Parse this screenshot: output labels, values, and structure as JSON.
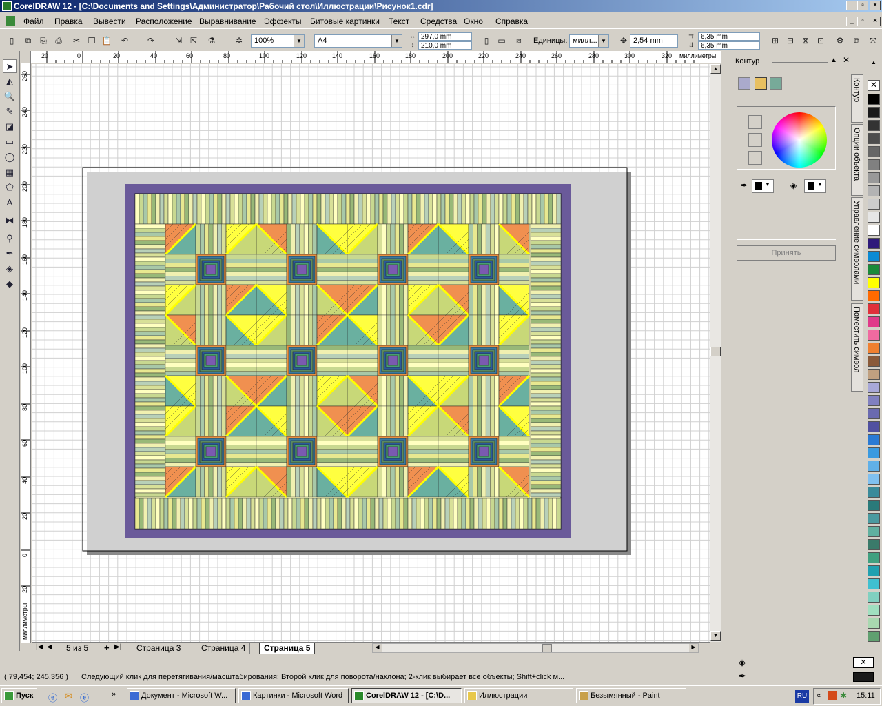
{
  "window": {
    "title": "CorelDRAW 12 - [C:\\Documents and Settings\\Администратор\\Рабочий стол\\Иллюстрации\\Рисунок1.cdr]"
  },
  "menu": [
    "Файл",
    "Правка",
    "Вывести",
    "Расположение",
    "Выравнивание",
    "Эффекты",
    "Битовые картинки",
    "Текст",
    "Средства",
    "Окно",
    "Справка"
  ],
  "toolbar": {
    "zoom": "100%",
    "paper": "A4",
    "width": "297,0 mm",
    "height": "210,0 mm",
    "units_label": "Единицы:",
    "units": "милл...",
    "nudge": "2,54 mm",
    "dup_x": "6,35 mm",
    "dup_y": "6,35 mm"
  },
  "ruler": {
    "h_ticks": [
      "20",
      "0",
      "20",
      "40",
      "60",
      "80",
      "100",
      "120",
      "140",
      "160",
      "180",
      "200",
      "220",
      "240",
      "260",
      "280",
      "300",
      "320"
    ],
    "h_unit": "миллиметры",
    "v_ticks": [
      "260",
      "240",
      "220",
      "200",
      "180",
      "160",
      "140",
      "120",
      "100",
      "80",
      "60",
      "40",
      "20",
      "0",
      "20"
    ],
    "v_unit": "миллиметры"
  },
  "pages": {
    "counter": "5 из 5",
    "tabs": [
      "Страница 3",
      "Страница 4",
      "Страница 5"
    ],
    "active": "Страница 5"
  },
  "docker": {
    "title": "Контур",
    "apply": "Принять",
    "tabs": [
      "Контур",
      "Опции объекта",
      "Управление символами",
      "Поместить символ"
    ]
  },
  "status": {
    "coords": "( 79,454; 245,356 )",
    "message": "Следующий клик для перетягивания/масштабирования; Второй клик для поворота/наклона; 2-клик выбирает все объекты; Shift+click м..."
  },
  "taskbar": {
    "start": "Пуск",
    "tasks": [
      "Документ - Microsoft W...",
      "Картинки - Microsoft Word",
      "CorelDRAW 12 - [C:\\D...",
      "Иллюстрации",
      "Безымянный - Paint"
    ],
    "lang": "RU",
    "clock": "15:11"
  },
  "colors": {
    "quilt_border": "#6a5a9a",
    "title_start": "#0a246a",
    "title_end": "#a6caf0",
    "palette": [
      "#000000",
      "#1a1a1a",
      "#333333",
      "#4d4d4d",
      "#666666",
      "#808080",
      "#999999",
      "#b3b3b3",
      "#cccccc",
      "#e6e6e6",
      "#ffffff",
      "#2e1a7a",
      "#0a8ad4",
      "#1a8a3a",
      "#ffff00",
      "#ff6a00",
      "#e0303a",
      "#e03a8a",
      "#f06aa0",
      "#f08030",
      "#8a5a3a",
      "#c0a080",
      "#a8a8d8",
      "#8080c0",
      "#6a6ab0",
      "#5050a0",
      "#2a7ad4",
      "#3a9ae0",
      "#60b0e8",
      "#80c0f0",
      "#3a8a9a",
      "#2a7a7a",
      "#4a9aa0",
      "#60b0a0",
      "#3a7a6a",
      "#40a080",
      "#20a0b0",
      "#40c0d0",
      "#80d0c0",
      "#a0e0c0",
      "#a8d8b0",
      "#60a070"
    ]
  }
}
